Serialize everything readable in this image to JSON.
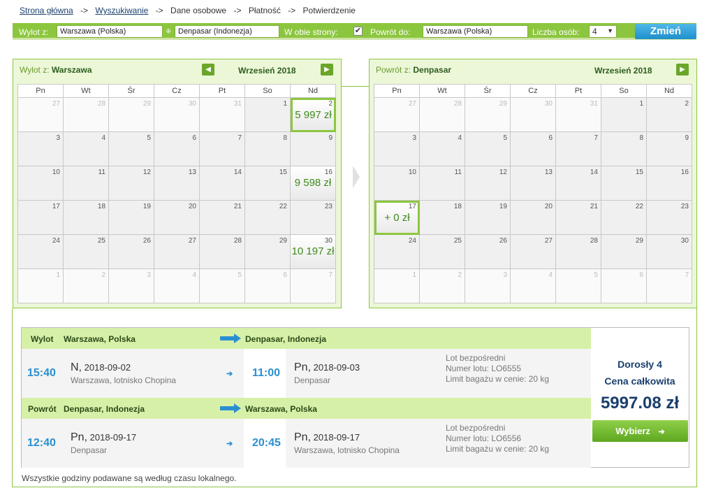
{
  "breadcrumb": {
    "home": "Strona główna",
    "search": "Wyszukiwanie",
    "personal": "Dane osobowe",
    "payment": "Płatność",
    "confirm": "Potwierdzenie",
    "sep": "->"
  },
  "search": {
    "from_label": "Wylot z:",
    "from_value": "Warszawa (Polska)",
    "to_value": "Denpasar (Indonezja)",
    "roundtrip_label": "W obie strony:",
    "roundtrip_checked": true,
    "return_label": "Powrót do:",
    "return_value": "Warszawa (Polska)",
    "pax_label": "Liczba osób:",
    "pax_value": "4",
    "change_button": "Zmień"
  },
  "weekdays": [
    "Pn",
    "Wt",
    "Śr",
    "Cz",
    "Pt",
    "So",
    "Nd"
  ],
  "outbound_calendar": {
    "title_prefix": "Wylot z:",
    "title_city": "Warszawa",
    "month": "Wrzesień 2018",
    "weeks": [
      [
        {
          "n": "27",
          "out": true
        },
        {
          "n": "28",
          "out": true
        },
        {
          "n": "29",
          "out": true
        },
        {
          "n": "30",
          "out": true
        },
        {
          "n": "31",
          "out": true
        },
        {
          "n": "1"
        },
        {
          "n": "2",
          "price": "5 997 zł",
          "selected": true
        }
      ],
      [
        {
          "n": "3"
        },
        {
          "n": "4"
        },
        {
          "n": "5"
        },
        {
          "n": "6"
        },
        {
          "n": "7"
        },
        {
          "n": "8"
        },
        {
          "n": "9"
        }
      ],
      [
        {
          "n": "10"
        },
        {
          "n": "11"
        },
        {
          "n": "12"
        },
        {
          "n": "13"
        },
        {
          "n": "14"
        },
        {
          "n": "15"
        },
        {
          "n": "16",
          "price": "9 598 zł"
        }
      ],
      [
        {
          "n": "17"
        },
        {
          "n": "18"
        },
        {
          "n": "19"
        },
        {
          "n": "20"
        },
        {
          "n": "21"
        },
        {
          "n": "22"
        },
        {
          "n": "23"
        }
      ],
      [
        {
          "n": "24"
        },
        {
          "n": "25"
        },
        {
          "n": "26"
        },
        {
          "n": "27"
        },
        {
          "n": "28"
        },
        {
          "n": "29"
        },
        {
          "n": "30",
          "price": "10 197 zł"
        }
      ],
      [
        {
          "n": "1",
          "out": true
        },
        {
          "n": "2",
          "out": true
        },
        {
          "n": "3",
          "out": true
        },
        {
          "n": "4",
          "out": true
        },
        {
          "n": "5",
          "out": true
        },
        {
          "n": "6",
          "out": true
        },
        {
          "n": "7",
          "out": true
        }
      ]
    ]
  },
  "return_calendar": {
    "title_prefix": "Powrót z:",
    "title_city": "Denpasar",
    "month": "Wrzesień 2018",
    "weeks": [
      [
        {
          "n": "27",
          "out": true
        },
        {
          "n": "28",
          "out": true
        },
        {
          "n": "29",
          "out": true
        },
        {
          "n": "30",
          "out": true
        },
        {
          "n": "31",
          "out": true
        },
        {
          "n": "1"
        },
        {
          "n": "2"
        }
      ],
      [
        {
          "n": "3"
        },
        {
          "n": "4"
        },
        {
          "n": "5"
        },
        {
          "n": "6"
        },
        {
          "n": "7"
        },
        {
          "n": "8"
        },
        {
          "n": "9"
        }
      ],
      [
        {
          "n": "10"
        },
        {
          "n": "11"
        },
        {
          "n": "12"
        },
        {
          "n": "13"
        },
        {
          "n": "14"
        },
        {
          "n": "15"
        },
        {
          "n": "16"
        }
      ],
      [
        {
          "n": "17",
          "price": "+ 0 zł",
          "selected": true
        },
        {
          "n": "18"
        },
        {
          "n": "19"
        },
        {
          "n": "20"
        },
        {
          "n": "21"
        },
        {
          "n": "22"
        },
        {
          "n": "23"
        }
      ],
      [
        {
          "n": "24"
        },
        {
          "n": "25"
        },
        {
          "n": "26"
        },
        {
          "n": "27"
        },
        {
          "n": "28"
        },
        {
          "n": "29"
        },
        {
          "n": "30"
        }
      ],
      [
        {
          "n": "1",
          "out": true
        },
        {
          "n": "2",
          "out": true
        },
        {
          "n": "3",
          "out": true
        },
        {
          "n": "4",
          "out": true
        },
        {
          "n": "5",
          "out": true
        },
        {
          "n": "6",
          "out": true
        },
        {
          "n": "7",
          "out": true
        }
      ]
    ]
  },
  "summary": {
    "outbound": {
      "label": "Wylot",
      "from": "Warszawa, Polska",
      "to": "Denpasar, Indonezja",
      "dep_time": "15:40",
      "dep_day": "N,",
      "dep_date": "2018-09-02",
      "dep_place": "Warszawa, lotnisko Chopina",
      "arr_time": "11:00",
      "arr_day": "Pn,",
      "arr_date": "2018-09-03",
      "arr_place": "Denpasar",
      "info1": "Lot bezpośredni",
      "info2": "Numer lotu: LO6555",
      "info3": "Limit bagażu w cenie: 20 kg"
    },
    "return": {
      "label": "Powrót",
      "from": "Denpasar, Indonezja",
      "to": "Warszawa, Polska",
      "dep_time": "12:40",
      "dep_day": "Pn,",
      "dep_date": "2018-09-17",
      "dep_place": "Denpasar",
      "arr_time": "20:45",
      "arr_day": "Pn,",
      "arr_date": "2018-09-17",
      "arr_place": "Warszawa, lotnisko Chopina",
      "info1": "Lot bezpośredni",
      "info2": "Numer lotu: LO6556",
      "info3": "Limit bagażu w cenie: 20 kg"
    },
    "pax": "Dorosły 4",
    "total_label": "Cena całkowita",
    "total": "5997.08 zł",
    "choose_button": "Wybierz"
  },
  "footnote": "Wszystkie godziny podawane są według czasu lokalnego.",
  "colors": {
    "accent_green": "#8cc63f",
    "price_green": "#3e8a1a",
    "time_blue": "#2a8fd0",
    "navy": "#1a3f6d"
  }
}
